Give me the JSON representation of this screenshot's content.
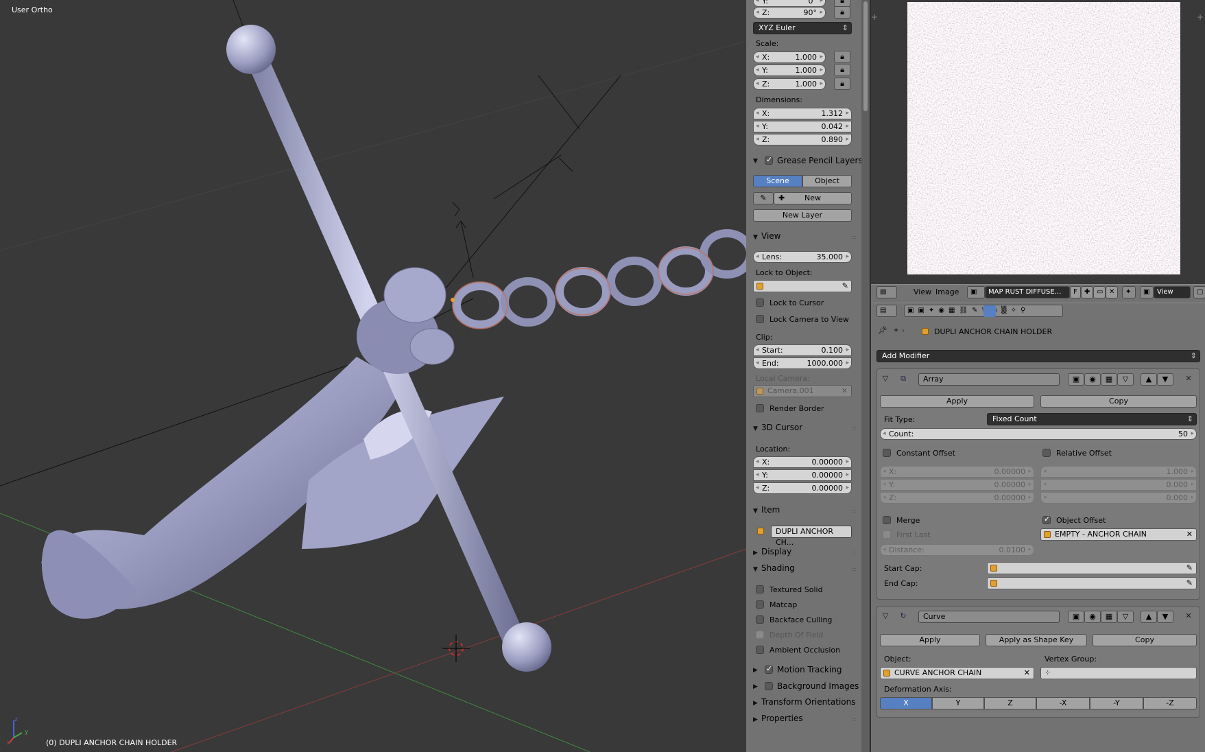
{
  "viewport": {
    "title": "User Ortho",
    "object_label": "(0) DUPLI ANCHOR CHAIN HOLDER",
    "axes": {
      "x": "x",
      "y": "y",
      "z": "z"
    }
  },
  "npanel": {
    "rotation": {
      "y_label": "Y:",
      "y_value": "0°",
      "z_label": "Z:",
      "z_value": "90°",
      "mode": "XYZ Euler"
    },
    "scale": {
      "label": "Scale:",
      "x_label": "X:",
      "x": "1.000",
      "y_label": "Y:",
      "y": "1.000",
      "z_label": "Z:",
      "z": "1.000"
    },
    "dimensions": {
      "label": "Dimensions:",
      "x_label": "X:",
      "x": "1.312",
      "y_label": "Y:",
      "y": "0.042",
      "z_label": "Z:",
      "z": "0.890"
    },
    "grease_pencil": {
      "title": "Grease Pencil Layers",
      "tab_scene": "Scene",
      "tab_object": "Object",
      "new": "New",
      "new_layer": "New Layer"
    },
    "view": {
      "title": "View",
      "lens_label": "Lens:",
      "lens": "35.000",
      "lock_object_label": "Lock to Object:",
      "lock_cursor": "Lock to Cursor",
      "lock_camera": "Lock Camera to View",
      "clip_label": "Clip:",
      "start_label": "Start:",
      "start": "0.100",
      "end_label": "End:",
      "end": "1000.000",
      "local_camera_label": "Local Camera:",
      "local_camera": "Camera.001",
      "render_border": "Render Border"
    },
    "cursor": {
      "title": "3D Cursor",
      "location_label": "Location:",
      "x_label": "X:",
      "x": "0.00000",
      "y_label": "Y:",
      "y": "0.00000",
      "z_label": "Z:",
      "z": "0.00000"
    },
    "item": {
      "title": "Item",
      "name": "DUPLI ANCHOR CH..."
    },
    "display": {
      "title": "Display"
    },
    "shading": {
      "title": "Shading",
      "textured_solid": "Textured Solid",
      "matcap": "Matcap",
      "backface": "Backface Culling",
      "dof": "Depth Of Field",
      "ao": "Ambient Occlusion"
    },
    "motion_tracking": "Motion Tracking",
    "background_images": "Background Images",
    "transform_orientations": "Transform Orientations",
    "properties": "Properties"
  },
  "image_editor": {
    "menu_view": "View",
    "menu_image": "Image",
    "image_name": "MAP RUST DIFFUSE...",
    "fake_user": "F",
    "view_mode": "View"
  },
  "properties": {
    "object_name": "DUPLI ANCHOR CHAIN HOLDER",
    "add_modifier": "Add Modifier",
    "array": {
      "name": "Array",
      "apply": "Apply",
      "copy": "Copy",
      "fit_type_label": "Fit Type:",
      "fit_type": "Fixed Count",
      "count_label": "Count:",
      "count": "50",
      "constant_offset": "Constant Offset",
      "relative_offset": "Relative Offset",
      "const": {
        "x_label": "X:",
        "x": "0.00000",
        "y_label": "Y:",
        "y": "0.00000",
        "z_label": "Z:",
        "z": "0.00000"
      },
      "rel": {
        "x": "1.000",
        "y": "0.000",
        "z": "0.000"
      },
      "merge": "Merge",
      "object_offset": "Object Offset",
      "first_last": "First Last",
      "offset_object": "EMPTY - ANCHOR CHAIN",
      "distance_label": "Distance:",
      "distance": "0.0100",
      "start_cap_label": "Start Cap:",
      "end_cap_label": "End Cap:"
    },
    "curve": {
      "name": "Curve",
      "apply": "Apply",
      "apply_shape": "Apply as Shape Key",
      "copy": "Copy",
      "object_label": "Object:",
      "object": "CURVE ANCHOR CHAIN",
      "vgroup_label": "Vertex Group:",
      "axis_label": "Deformation Axis:",
      "axes": [
        "X",
        "Y",
        "Z",
        "-X",
        "-Y",
        "-Z"
      ],
      "selected_axis": "X"
    }
  }
}
